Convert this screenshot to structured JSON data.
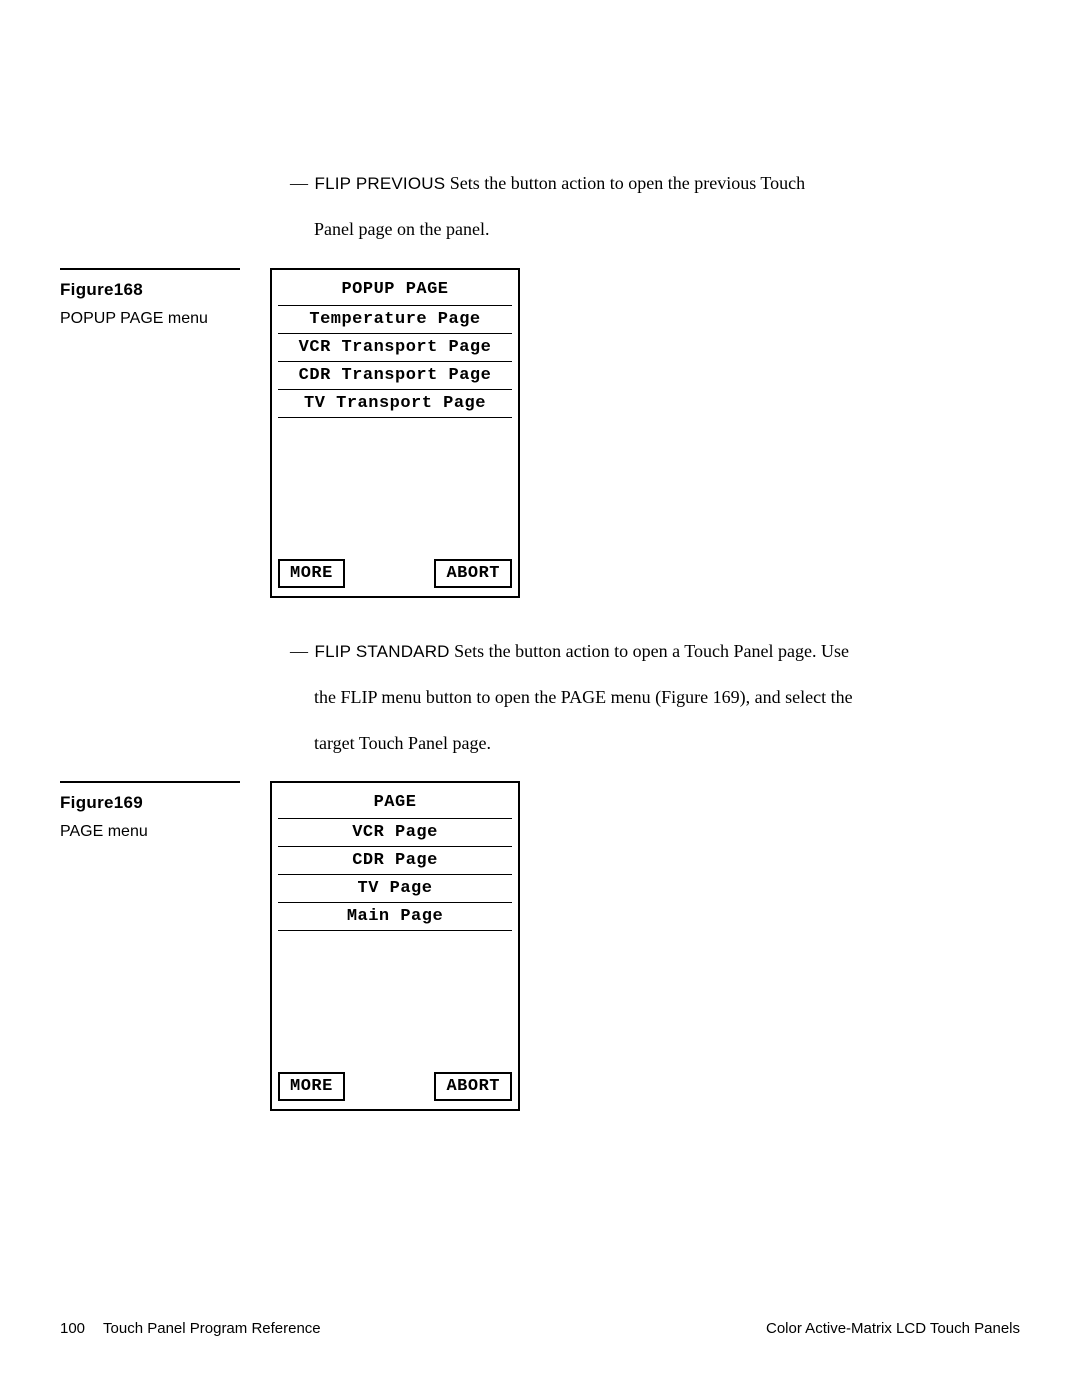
{
  "section1": {
    "term": "FLIP PREVIOUS",
    "desc_tail": " Sets the button action to open the previous Touch",
    "cont": "Panel page on the panel."
  },
  "fig1": {
    "label": "Figure168",
    "caption": "POPUP PAGE menu",
    "panel_title": "POPUP PAGE",
    "items": [
      "Temperature Page",
      "VCR Transport Page",
      "CDR Transport Page",
      "TV Transport Page"
    ],
    "more": "MORE",
    "abort": "ABORT"
  },
  "section2": {
    "term": "FLIP STANDARD",
    "desc_tail": " Sets the button action to open a Touch Panel page. Use",
    "cont1": "the FLIP menu button to open the PAGE menu (Figure 169), and select the",
    "cont2": "target Touch Panel page."
  },
  "fig2": {
    "label": "Figure169",
    "caption": "PAGE menu",
    "panel_title": "PAGE",
    "items": [
      "VCR Page",
      "CDR Page",
      "TV Page",
      "Main Page"
    ],
    "more": "MORE",
    "abort": "ABORT"
  },
  "footer": {
    "page_number": "100",
    "left_text": "Touch Panel Program Reference",
    "right_text": "Color Active-Matrix LCD Touch Panels"
  },
  "dash": "— "
}
